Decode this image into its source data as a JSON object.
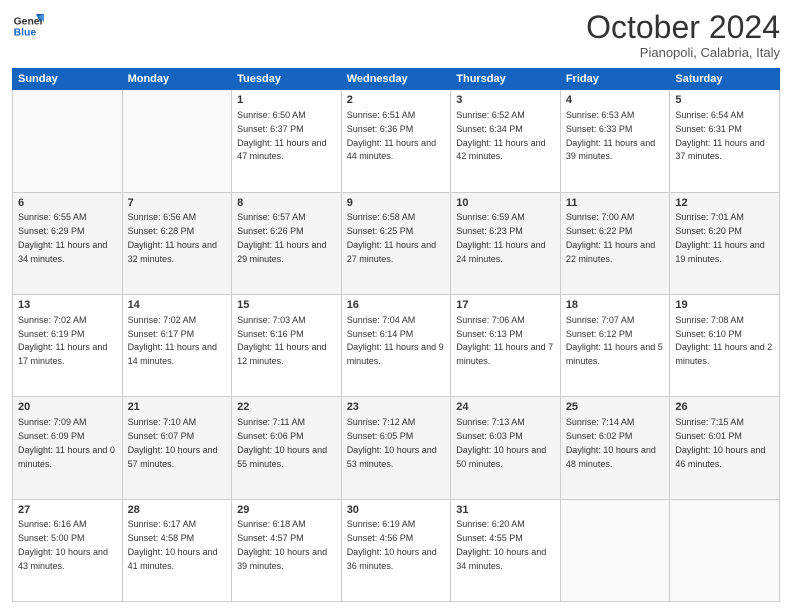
{
  "logo": {
    "line1": "General",
    "line2": "Blue"
  },
  "header": {
    "month": "October 2024",
    "location": "Pianopoli, Calabria, Italy"
  },
  "weekdays": [
    "Sunday",
    "Monday",
    "Tuesday",
    "Wednesday",
    "Thursday",
    "Friday",
    "Saturday"
  ],
  "weeks": [
    [
      {
        "day": null,
        "sunrise": null,
        "sunset": null,
        "daylight": null
      },
      {
        "day": null,
        "sunrise": null,
        "sunset": null,
        "daylight": null
      },
      {
        "day": "1",
        "sunrise": "Sunrise: 6:50 AM",
        "sunset": "Sunset: 6:37 PM",
        "daylight": "Daylight: 11 hours and 47 minutes."
      },
      {
        "day": "2",
        "sunrise": "Sunrise: 6:51 AM",
        "sunset": "Sunset: 6:36 PM",
        "daylight": "Daylight: 11 hours and 44 minutes."
      },
      {
        "day": "3",
        "sunrise": "Sunrise: 6:52 AM",
        "sunset": "Sunset: 6:34 PM",
        "daylight": "Daylight: 11 hours and 42 minutes."
      },
      {
        "day": "4",
        "sunrise": "Sunrise: 6:53 AM",
        "sunset": "Sunset: 6:33 PM",
        "daylight": "Daylight: 11 hours and 39 minutes."
      },
      {
        "day": "5",
        "sunrise": "Sunrise: 6:54 AM",
        "sunset": "Sunset: 6:31 PM",
        "daylight": "Daylight: 11 hours and 37 minutes."
      }
    ],
    [
      {
        "day": "6",
        "sunrise": "Sunrise: 6:55 AM",
        "sunset": "Sunset: 6:29 PM",
        "daylight": "Daylight: 11 hours and 34 minutes."
      },
      {
        "day": "7",
        "sunrise": "Sunrise: 6:56 AM",
        "sunset": "Sunset: 6:28 PM",
        "daylight": "Daylight: 11 hours and 32 minutes."
      },
      {
        "day": "8",
        "sunrise": "Sunrise: 6:57 AM",
        "sunset": "Sunset: 6:26 PM",
        "daylight": "Daylight: 11 hours and 29 minutes."
      },
      {
        "day": "9",
        "sunrise": "Sunrise: 6:58 AM",
        "sunset": "Sunset: 6:25 PM",
        "daylight": "Daylight: 11 hours and 27 minutes."
      },
      {
        "day": "10",
        "sunrise": "Sunrise: 6:59 AM",
        "sunset": "Sunset: 6:23 PM",
        "daylight": "Daylight: 11 hours and 24 minutes."
      },
      {
        "day": "11",
        "sunrise": "Sunrise: 7:00 AM",
        "sunset": "Sunset: 6:22 PM",
        "daylight": "Daylight: 11 hours and 22 minutes."
      },
      {
        "day": "12",
        "sunrise": "Sunrise: 7:01 AM",
        "sunset": "Sunset: 6:20 PM",
        "daylight": "Daylight: 11 hours and 19 minutes."
      }
    ],
    [
      {
        "day": "13",
        "sunrise": "Sunrise: 7:02 AM",
        "sunset": "Sunset: 6:19 PM",
        "daylight": "Daylight: 11 hours and 17 minutes."
      },
      {
        "day": "14",
        "sunrise": "Sunrise: 7:02 AM",
        "sunset": "Sunset: 6:17 PM",
        "daylight": "Daylight: 11 hours and 14 minutes."
      },
      {
        "day": "15",
        "sunrise": "Sunrise: 7:03 AM",
        "sunset": "Sunset: 6:16 PM",
        "daylight": "Daylight: 11 hours and 12 minutes."
      },
      {
        "day": "16",
        "sunrise": "Sunrise: 7:04 AM",
        "sunset": "Sunset: 6:14 PM",
        "daylight": "Daylight: 11 hours and 9 minutes."
      },
      {
        "day": "17",
        "sunrise": "Sunrise: 7:06 AM",
        "sunset": "Sunset: 6:13 PM",
        "daylight": "Daylight: 11 hours and 7 minutes."
      },
      {
        "day": "18",
        "sunrise": "Sunrise: 7:07 AM",
        "sunset": "Sunset: 6:12 PM",
        "daylight": "Daylight: 11 hours and 5 minutes."
      },
      {
        "day": "19",
        "sunrise": "Sunrise: 7:08 AM",
        "sunset": "Sunset: 6:10 PM",
        "daylight": "Daylight: 11 hours and 2 minutes."
      }
    ],
    [
      {
        "day": "20",
        "sunrise": "Sunrise: 7:09 AM",
        "sunset": "Sunset: 6:09 PM",
        "daylight": "Daylight: 11 hours and 0 minutes."
      },
      {
        "day": "21",
        "sunrise": "Sunrise: 7:10 AM",
        "sunset": "Sunset: 6:07 PM",
        "daylight": "Daylight: 10 hours and 57 minutes."
      },
      {
        "day": "22",
        "sunrise": "Sunrise: 7:11 AM",
        "sunset": "Sunset: 6:06 PM",
        "daylight": "Daylight: 10 hours and 55 minutes."
      },
      {
        "day": "23",
        "sunrise": "Sunrise: 7:12 AM",
        "sunset": "Sunset: 6:05 PM",
        "daylight": "Daylight: 10 hours and 53 minutes."
      },
      {
        "day": "24",
        "sunrise": "Sunrise: 7:13 AM",
        "sunset": "Sunset: 6:03 PM",
        "daylight": "Daylight: 10 hours and 50 minutes."
      },
      {
        "day": "25",
        "sunrise": "Sunrise: 7:14 AM",
        "sunset": "Sunset: 6:02 PM",
        "daylight": "Daylight: 10 hours and 48 minutes."
      },
      {
        "day": "26",
        "sunrise": "Sunrise: 7:15 AM",
        "sunset": "Sunset: 6:01 PM",
        "daylight": "Daylight: 10 hours and 46 minutes."
      }
    ],
    [
      {
        "day": "27",
        "sunrise": "Sunrise: 6:16 AM",
        "sunset": "Sunset: 5:00 PM",
        "daylight": "Daylight: 10 hours and 43 minutes."
      },
      {
        "day": "28",
        "sunrise": "Sunrise: 6:17 AM",
        "sunset": "Sunset: 4:58 PM",
        "daylight": "Daylight: 10 hours and 41 minutes."
      },
      {
        "day": "29",
        "sunrise": "Sunrise: 6:18 AM",
        "sunset": "Sunset: 4:57 PM",
        "daylight": "Daylight: 10 hours and 39 minutes."
      },
      {
        "day": "30",
        "sunrise": "Sunrise: 6:19 AM",
        "sunset": "Sunset: 4:56 PM",
        "daylight": "Daylight: 10 hours and 36 minutes."
      },
      {
        "day": "31",
        "sunrise": "Sunrise: 6:20 AM",
        "sunset": "Sunset: 4:55 PM",
        "daylight": "Daylight: 10 hours and 34 minutes."
      },
      {
        "day": null,
        "sunrise": null,
        "sunset": null,
        "daylight": null
      },
      {
        "day": null,
        "sunrise": null,
        "sunset": null,
        "daylight": null
      }
    ]
  ]
}
